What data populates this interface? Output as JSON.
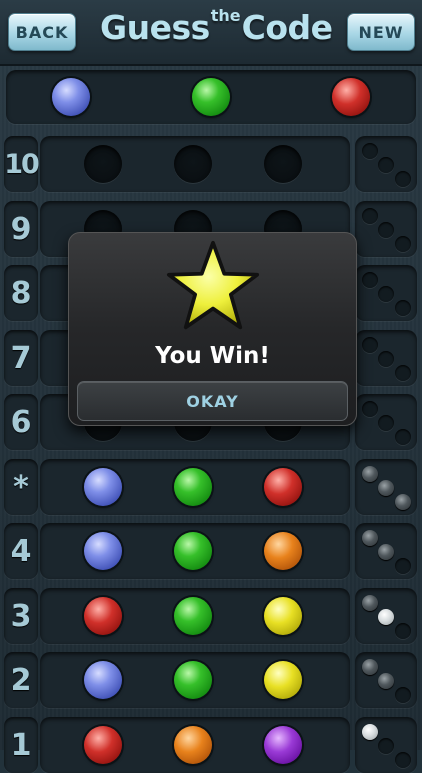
{
  "header": {
    "back_label": "BACK",
    "new_label": "NEW",
    "title_part1": "Guess",
    "title_part2": "the",
    "title_part3": "Code"
  },
  "secret_code": [
    "blue",
    "green",
    "red"
  ],
  "rows": [
    {
      "label": "10",
      "pegs": [
        "empty",
        "empty",
        "empty"
      ],
      "feedback": [
        "empty",
        "empty",
        "empty"
      ]
    },
    {
      "label": "9",
      "pegs": [
        "empty",
        "empty",
        "empty"
      ],
      "feedback": [
        "empty",
        "empty",
        "empty"
      ]
    },
    {
      "label": "8",
      "pegs": [
        "empty",
        "empty",
        "empty"
      ],
      "feedback": [
        "empty",
        "empty",
        "empty"
      ]
    },
    {
      "label": "7",
      "pegs": [
        "empty",
        "empty",
        "empty"
      ],
      "feedback": [
        "empty",
        "empty",
        "empty"
      ]
    },
    {
      "label": "6",
      "pegs": [
        "empty",
        "empty",
        "empty"
      ],
      "feedback": [
        "empty",
        "empty",
        "empty"
      ]
    },
    {
      "label": "*",
      "pegs": [
        "blue",
        "green",
        "red"
      ],
      "feedback": [
        "black",
        "black",
        "black"
      ]
    },
    {
      "label": "4",
      "pegs": [
        "blue",
        "green",
        "orange"
      ],
      "feedback": [
        "black",
        "black",
        "empty"
      ]
    },
    {
      "label": "3",
      "pegs": [
        "red",
        "green",
        "yellow"
      ],
      "feedback": [
        "black",
        "white",
        "empty"
      ]
    },
    {
      "label": "2",
      "pegs": [
        "blue",
        "green",
        "yellow"
      ],
      "feedback": [
        "black",
        "black",
        "empty"
      ]
    },
    {
      "label": "1",
      "pegs": [
        "red",
        "orange",
        "purple"
      ],
      "feedback": [
        "white",
        "empty",
        "empty"
      ]
    }
  ],
  "dialog": {
    "icon": "star-icon",
    "message": "You Win!",
    "button_label": "OKAY"
  }
}
